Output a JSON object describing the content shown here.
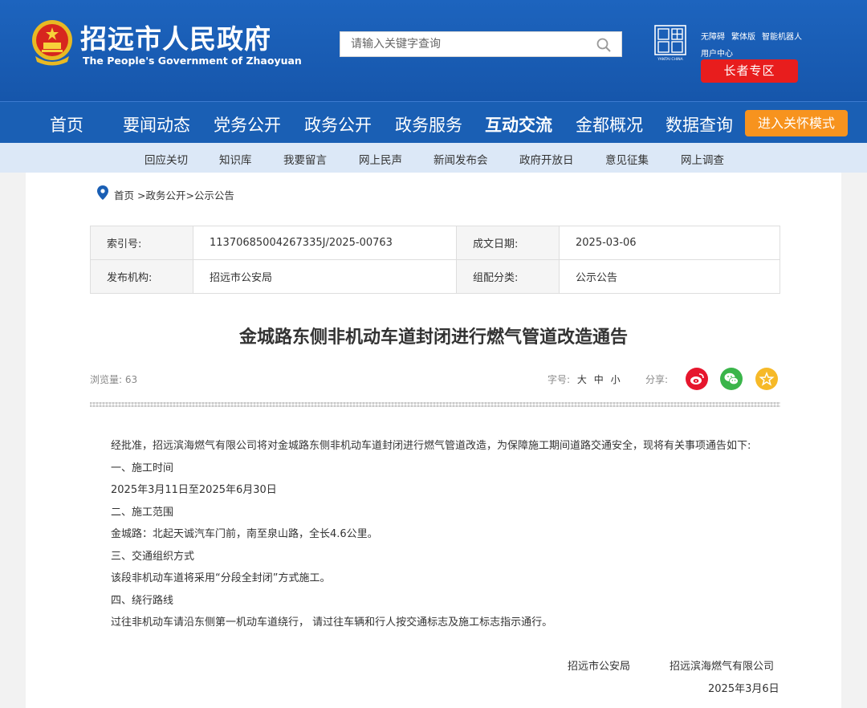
{
  "header": {
    "title_cn": "招远市人民政府",
    "title_en": "The People's Government of Zhaoyuan",
    "search_placeholder": "请输入关键字查询",
    "top_links": [
      "无障碍",
      "繁体版",
      "智能机器人"
    ],
    "user_center": "用户中心",
    "elder_zone": "长者专区",
    "seal_caption": "YANTAI CHINA"
  },
  "main_nav": {
    "items": [
      "首页",
      "要闻动态",
      "党务公开",
      "政务公开",
      "政务服务",
      "互动交流",
      "金都概况",
      "数据查询"
    ],
    "active": "互动交流",
    "care_mode": "进入关怀模式"
  },
  "sub_nav": {
    "items": [
      "回应关切",
      "知识库",
      "我要留言",
      "网上民声",
      "新闻发布会",
      "政府开放日",
      "意见征集",
      "网上调查"
    ]
  },
  "breadcrumb": "首页 >政务公开>公示公告",
  "meta": {
    "index_label": "索引号:",
    "index_value": "11370685004267335J/2025-00763",
    "date_label": "成文日期:",
    "date_value": "2025-03-06",
    "publisher_label": "发布机构:",
    "publisher_value": "招远市公安局",
    "category_label": "组配分类:",
    "category_value": "公示公告"
  },
  "article": {
    "title": "金城路东侧非机动车道封闭进行燃气管道改造通告",
    "views": "浏览量: 63",
    "font_size_label": "字号:",
    "font_sizes": [
      "大",
      "中",
      "小"
    ],
    "share_label": "分享:",
    "paragraphs": [
      "经批准，招远滨海燃气有限公司将对金城路东侧非机动车道封闭进行燃气管道改造，为保障施工期间道路交通安全，现将有关事项通告如下:",
      "一、施工时间",
      "2025年3月11日至2025年6月30日",
      "二、施工范围",
      "金城路：北起天诚汽车门前，南至泉山路，全长4.6公里。",
      "三、交通组织方式",
      "该段非机动车道将采用“分段全封闭”方式施工。",
      "四、绕行路线",
      "过往非机动车请沿东侧第一机动车道绕行， 请过往车辆和行人按交通标志及施工标志指示通行。"
    ],
    "signer_1": "招远市公安局",
    "signer_2": "招远滨海燃气有限公司",
    "sign_date": "2025年3月6日"
  },
  "colors": {
    "header_blue": "#1a5fb4",
    "subnav_bg": "#dce8f7",
    "elder_red": "#e81d1d",
    "care_orange": "#f7931e"
  }
}
